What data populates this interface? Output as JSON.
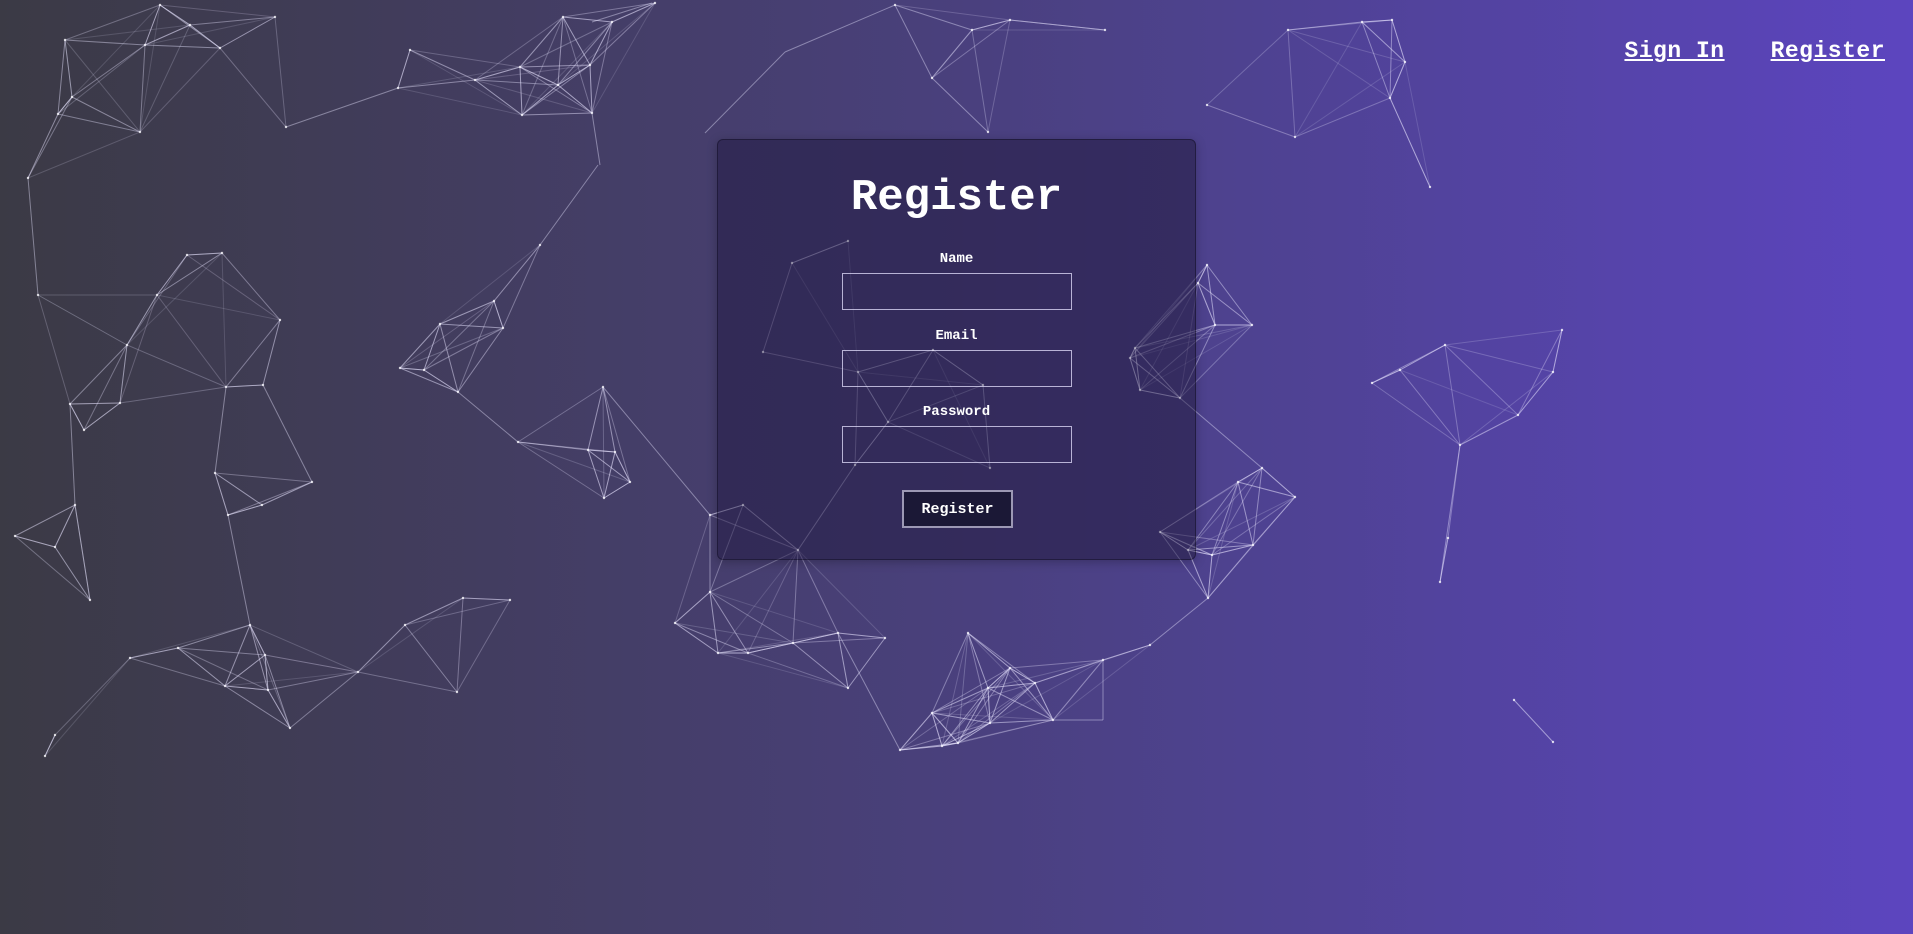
{
  "nav": {
    "sign_in": "Sign In",
    "register": "Register"
  },
  "form": {
    "title": "Register",
    "fields": [
      {
        "label": "Name",
        "value": ""
      },
      {
        "label": "Email",
        "value": ""
      },
      {
        "label": "Password",
        "value": ""
      }
    ],
    "submit_label": "Register"
  },
  "colors": {
    "background_start": "#3b3a45",
    "background_end": "#5c45bf",
    "card": "#2d2450",
    "button": "#1b1836"
  }
}
